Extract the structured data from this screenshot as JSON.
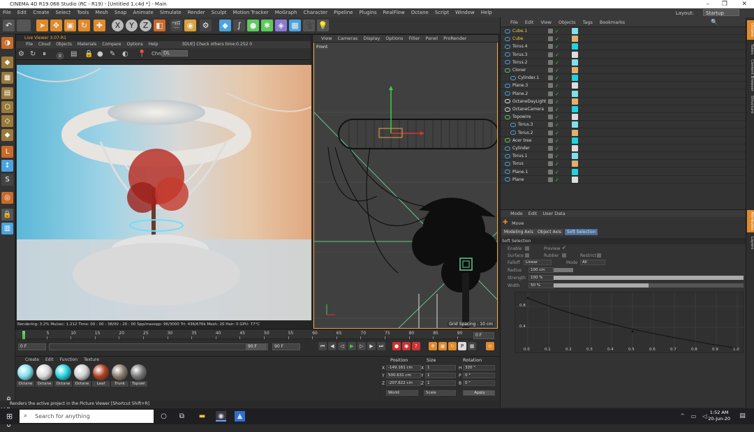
{
  "window": {
    "title": "CINEMA 4D R19.068 Studio (RC - R19) - [Untitled 1.c4d *] - Main"
  },
  "menu": [
    "File",
    "Edit",
    "Create",
    "Select",
    "Tools",
    "Mesh",
    "Snap",
    "Animate",
    "Simulate",
    "Render",
    "Sculpt",
    "Motion Tracker",
    "MoGraph",
    "Character",
    "Pipeline",
    "Plugins",
    "RealFlow",
    "Octane",
    "Script",
    "Window",
    "Help"
  ],
  "layout": {
    "label": "Layout:",
    "value": "Startup"
  },
  "live_viewer": {
    "title": "Live Viewer 3.07-R1",
    "menu": [
      "File",
      "Cloud",
      "Objects",
      "Materials",
      "Compare",
      "Options",
      "Help"
    ],
    "message": "3DUE] Check others time:0.252  0",
    "channel_label": "Chn:",
    "channel_value": "DL",
    "status": "Rendering: 3.2%   Ms/sec: 1.212   Time: 00 : 00 : 38/00 : 20 : 00   Spp/maxspp: 96/3000   Tri: 436/676k   Mesh: 20   Hair: 0    GPU:   77°C"
  },
  "viewport": {
    "menu": [
      "View",
      "Cameras",
      "Display",
      "Options",
      "Filter",
      "Panel",
      "ProRender"
    ],
    "label": "Front",
    "grid_spacing": "Grid Spacing : 10 cm"
  },
  "timeline": {
    "ticks": [
      "0",
      "5",
      "10",
      "15",
      "20",
      "25",
      "30",
      "35",
      "40",
      "45",
      "50",
      "55",
      "60",
      "65",
      "70",
      "75",
      "80",
      "85",
      "90"
    ],
    "start_field": "0 F",
    "end_field": "90 F",
    "current_field": "90 F",
    "frame_display": "0 F"
  },
  "material_manager": {
    "menu": [
      "Create",
      "Edit",
      "Function",
      "Texture"
    ],
    "materials": [
      {
        "name": "Octane",
        "color": "#7fe0ec"
      },
      {
        "name": "Octane",
        "color": "#d8d8d8"
      },
      {
        "name": "Octane",
        "color": "#21d2e0"
      },
      {
        "name": "Octane",
        "color": "#d0d0d0"
      },
      {
        "name": "Leaf",
        "color": "#b04020"
      },
      {
        "name": "Trunk",
        "color": "#8a7a6a"
      },
      {
        "name": "Topowi",
        "color": "#777777"
      }
    ]
  },
  "coordinates": {
    "headers": [
      "Position",
      "Size",
      "Rotation"
    ],
    "rows": [
      {
        "axis": "X",
        "pos": "-149.161 cm",
        "s_axis": "X",
        "size": "1",
        "r_axis": "H",
        "rot": "320 °"
      },
      {
        "axis": "Y",
        "pos": "500.631 cm",
        "s_axis": "Y",
        "size": "1",
        "r_axis": "P",
        "rot": "0 °"
      },
      {
        "axis": "Z",
        "pos": "-207.622 cm",
        "s_axis": "Z",
        "size": "1",
        "r_axis": "B",
        "rot": "0 °"
      }
    ],
    "mode": "World",
    "scale": "Scale",
    "apply": "Apply"
  },
  "status_line": "Renders the active project in the Picture Viewer [Shortcut Shift+R]",
  "object_manager": {
    "menu": [
      "File",
      "Edit",
      "View",
      "Objects",
      "Tags",
      "Bookmarks"
    ],
    "objects": [
      {
        "name": "Cube.1",
        "indent": 0,
        "color": "#4aa3df",
        "highlight": true
      },
      {
        "name": "Cube",
        "indent": 0,
        "color": "#4aa3df",
        "highlight": true
      },
      {
        "name": "Torus.4",
        "indent": 0,
        "color": "#4aa3df",
        "highlight": false
      },
      {
        "name": "Torus.3",
        "indent": 0,
        "color": "#4aa3df",
        "highlight": false
      },
      {
        "name": "Torus.2",
        "indent": 0,
        "color": "#4aa3df",
        "highlight": false
      },
      {
        "name": "Cloner",
        "indent": 0,
        "color": "#5ec95e",
        "highlight": false
      },
      {
        "name": "Cylinder.1",
        "indent": 1,
        "color": "#4aa3df",
        "highlight": false
      },
      {
        "name": "Plane.3",
        "indent": 0,
        "color": "#4aa3df",
        "highlight": false
      },
      {
        "name": "Plane.2",
        "indent": 0,
        "color": "#4aa3df",
        "highlight": false
      },
      {
        "name": "OctaneDayLight",
        "indent": 0,
        "color": "#dddddd",
        "highlight": false
      },
      {
        "name": "OctaneCamera",
        "indent": 0,
        "color": "#dddddd",
        "highlight": false
      },
      {
        "name": "Topowire",
        "indent": 0,
        "color": "#5ec95e",
        "highlight": false
      },
      {
        "name": "Torus.3",
        "indent": 1,
        "color": "#4aa3df",
        "highlight": false
      },
      {
        "name": "Torus.2",
        "indent": 1,
        "color": "#4aa3df",
        "highlight": false
      },
      {
        "name": "Acer tree",
        "indent": 0,
        "color": "#5ec95e",
        "highlight": false
      },
      {
        "name": "Cylinder",
        "indent": 0,
        "color": "#4aa3df",
        "highlight": false
      },
      {
        "name": "Torus.1",
        "indent": 0,
        "color": "#4aa3df",
        "highlight": false
      },
      {
        "name": "Torus",
        "indent": 0,
        "color": "#4aa3df",
        "highlight": false
      },
      {
        "name": "Plane.1",
        "indent": 0,
        "color": "#4aa3df",
        "highlight": false
      },
      {
        "name": "Plane",
        "indent": 0,
        "color": "#4aa3df",
        "highlight": false
      }
    ]
  },
  "attribute_manager": {
    "menu": [
      "Mode",
      "Edit",
      "User Data"
    ],
    "tool": "Move",
    "tabs": [
      "Modeling Axis",
      "Object Axis",
      "Soft Selection"
    ],
    "section": "Soft Selection",
    "fields": {
      "enable": "Enable",
      "preview": "Preview",
      "surface": "Surface",
      "rubber": "Rubber",
      "restrict": "Restrict",
      "falloff": "Falloff",
      "falloff_value": "Linear",
      "mode": "Mode",
      "mode_value": "All",
      "radius": "Radius",
      "radius_value": "100 cm",
      "strength": "Strength",
      "strength_value": "100 %",
      "strength_level": 1.0,
      "width": "Width",
      "width_value": "50 %",
      "width_level": 0.5
    },
    "graph": {
      "y_ticks": [
        "0.8",
        "0.4"
      ],
      "x_ticks": [
        "0.0",
        "0.1",
        "0.2",
        "0.3",
        "0.4",
        "0.5",
        "0.6",
        "0.7",
        "0.8",
        "0.9",
        "1.0"
      ]
    }
  },
  "side_tabs": [
    "Octane",
    "Takes",
    "Content Browser",
    "Structure",
    "Attributes",
    "Layers"
  ],
  "taskbar": {
    "search_placeholder": "Search for anything",
    "time": "1:52 AM",
    "date": "20-Jun-20"
  }
}
